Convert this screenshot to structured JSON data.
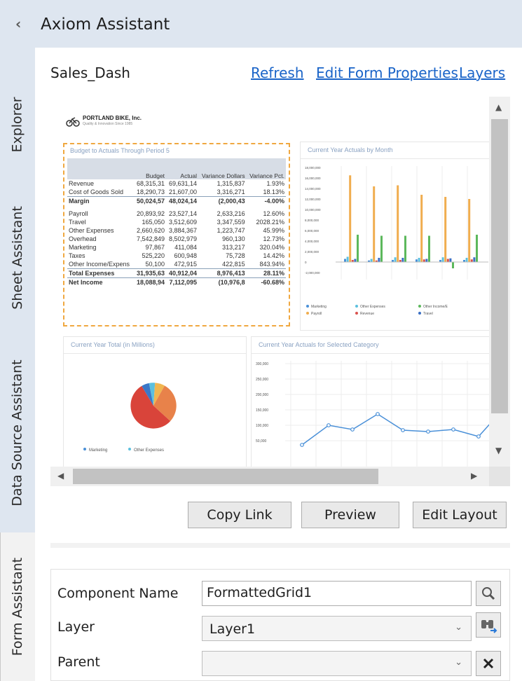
{
  "window": {
    "title": "Axiom Assistant",
    "collapse_icon": "chevron-left-icon"
  },
  "tabs": [
    {
      "label": "Explorer"
    },
    {
      "label": "Sheet Assistant"
    },
    {
      "label": "Data Source Assistant"
    },
    {
      "label": "Form Assistant"
    }
  ],
  "form": {
    "name": "Sales_Dash",
    "links": {
      "refresh": "Refresh",
      "edit_props": "Edit Form Properties",
      "layers": "Layers"
    }
  },
  "preview": {
    "company": {
      "name": "PORTLAND BIKE, Inc.",
      "tagline": "Quality & Innovation Since 1985"
    },
    "budget": {
      "title": "Budget to Actuals Through Period 5",
      "headers": [
        "",
        "Budget",
        "Actual",
        "Variance Dollars",
        "Variance Pct."
      ],
      "rows": [
        {
          "label": "Revenue",
          "budget": "68,315,31",
          "actual": "69,631,14",
          "var": "1,315,837",
          "pct": "1.93%"
        },
        {
          "label": "Cost of Goods Sold",
          "budget": "18,290,73",
          "actual": "21,607,00",
          "var": "3,316,271",
          "pct": "18.13%"
        },
        {
          "label": "Margin",
          "budget": "50,024,57",
          "actual": "48,024,14",
          "var": "(2,000,43",
          "pct": "-4.00%"
        },
        {
          "label": "Payroll",
          "budget": "20,893,92",
          "actual": "23,527,14",
          "var": "2,633,216",
          "pct": "12.60%"
        },
        {
          "label": "Travel",
          "budget": "165,050",
          "actual": "3,512,609",
          "var": "3,347,559",
          "pct": "2028.21%"
        },
        {
          "label": "Other Expenses",
          "budget": "2,660,620",
          "actual": "3,884,367",
          "var": "1,223,747",
          "pct": "45.99%"
        },
        {
          "label": "Overhead",
          "budget": "7,542,849",
          "actual": "8,502,979",
          "var": "960,130",
          "pct": "12.73%"
        },
        {
          "label": "Marketing",
          "budget": "97,867",
          "actual": "411,084",
          "var": "313,217",
          "pct": "320.04%"
        },
        {
          "label": "Taxes",
          "budget": "525,220",
          "actual": "600,948",
          "var": "75,728",
          "pct": "14.42%"
        },
        {
          "label": "Other Income/Expens",
          "budget": "50,100",
          "actual": "472,915",
          "var": "422,815",
          "pct": "843.94%"
        },
        {
          "label": "Total Expenses",
          "budget": "31,935,63",
          "actual": "40,912,04",
          "var": "8,976,413",
          "pct": "28.11%"
        },
        {
          "label": "Net Income",
          "budget": "18,088,94",
          "actual": "7,112,095",
          "var": "(10,976,8",
          "pct": "-60.68%"
        }
      ]
    },
    "monthly": {
      "title": "Current Year Actuals by Month",
      "y_ticks": [
        "18,000,000",
        "16,000,000",
        "14,000,000",
        "12,000,000",
        "10,000,000",
        "8,000,000",
        "6,000,000",
        "4,000,000",
        "2,000,000",
        "0",
        "-2,000,000"
      ],
      "legend": [
        "Marketing",
        "Other Expenses",
        "Other Income/E",
        "Payroll",
        "Revenue",
        "Travel"
      ],
      "colors": {
        "Marketing": "#4a90d8",
        "Other Expenses": "#5bc0de",
        "Other Income/E": "#5cb85c",
        "Payroll": "#f0ad4e",
        "Revenue": "#d9534f",
        "Travel": "#3a6fc4"
      }
    },
    "pie": {
      "title": "Current Year Total (in Millions)",
      "legend": [
        "Marketing",
        "Other Expenses"
      ]
    },
    "line": {
      "title": "Current Year Actuals for Selected Category",
      "y_ticks": [
        "300,000",
        "250,000",
        "200,000",
        "150,000",
        "100,000",
        "50,000"
      ]
    }
  },
  "buttons": {
    "copy_link": "Copy Link",
    "preview": "Preview",
    "edit_layout": "Edit Layout"
  },
  "props": {
    "component_label": "Component Name",
    "component_value": "FormattedGrid1",
    "layer_label": "Layer",
    "layer_value": "Layer1",
    "parent_label": "Parent",
    "parent_value": ""
  }
}
